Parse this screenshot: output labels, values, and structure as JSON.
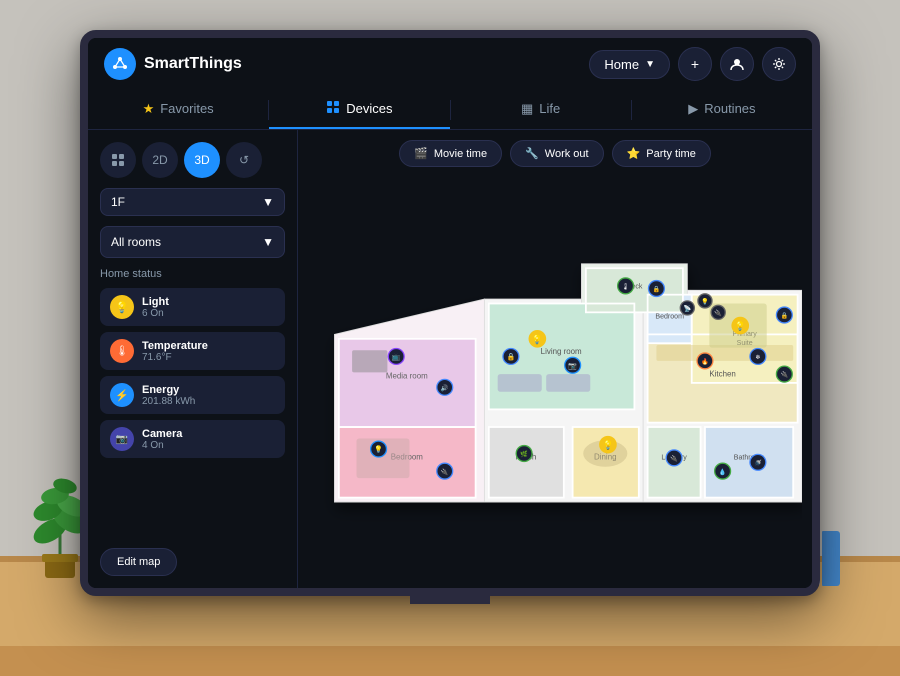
{
  "app": {
    "title": "SmartThings"
  },
  "header": {
    "logo_text": "SmartThings",
    "home_selector": "Home",
    "add_label": "+",
    "profile_label": "👤",
    "settings_label": "⚙"
  },
  "nav": {
    "tabs": [
      {
        "id": "favorites",
        "label": "Favorites",
        "icon": "★",
        "active": false
      },
      {
        "id": "devices",
        "label": "Devices",
        "icon": "⊞",
        "active": true
      },
      {
        "id": "life",
        "label": "Life",
        "icon": "▦",
        "active": false
      },
      {
        "id": "routines",
        "label": "Routines",
        "icon": "▶",
        "active": false
      }
    ]
  },
  "sidebar": {
    "view_buttons": [
      {
        "id": "grid",
        "label": "⊞",
        "active": false
      },
      {
        "id": "2d",
        "label": "2D",
        "active": false
      },
      {
        "id": "3d",
        "label": "3D",
        "active": true
      },
      {
        "id": "history",
        "label": "↺",
        "active": false
      }
    ],
    "floor": "1F",
    "rooms": "All rooms",
    "home_status_title": "Home status",
    "status_items": [
      {
        "id": "light",
        "icon": "💡",
        "type": "light",
        "name": "Light",
        "value": "6 On"
      },
      {
        "id": "temperature",
        "icon": "🌡",
        "type": "temp",
        "name": "Temperature",
        "value": "71.6°F"
      },
      {
        "id": "energy",
        "icon": "⚡",
        "type": "energy",
        "name": "Energy",
        "value": "201.88 kWh"
      },
      {
        "id": "camera",
        "icon": "📷",
        "type": "camera",
        "name": "Camera",
        "value": "4 On"
      }
    ],
    "edit_map_label": "Edit map"
  },
  "scenes": [
    {
      "id": "movie",
      "icon": "🎬",
      "label": "Movie time"
    },
    {
      "id": "workout",
      "icon": "🔧",
      "label": "Work out"
    },
    {
      "id": "party",
      "icon": "⭐",
      "label": "Party time"
    }
  ],
  "colors": {
    "accent": "#1e90ff",
    "background": "#0d1117",
    "sidebar_bg": "#0d1117",
    "card_bg": "#1a2035",
    "text_primary": "#ffffff",
    "text_secondary": "#8899aa"
  }
}
